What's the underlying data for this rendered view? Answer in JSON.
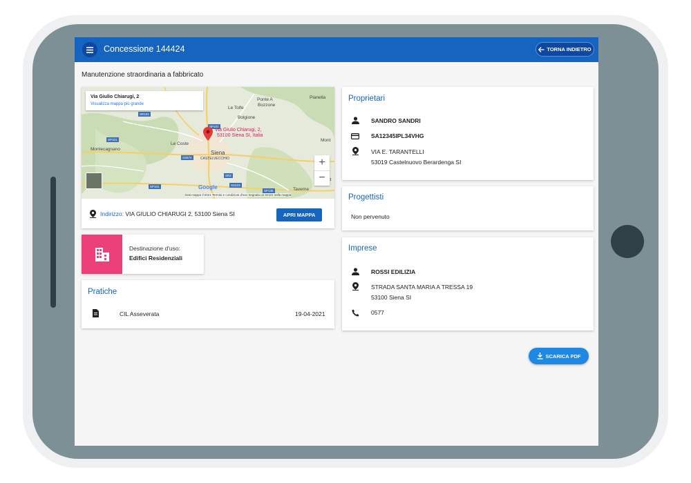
{
  "app": {
    "title": "Concessione 144424",
    "back_label": "TORNA INDIETRO",
    "menu_icon": "menu-icon",
    "primary_color": "#1565c0"
  },
  "page": {
    "subtitle": "Manutenzione straordinaria a fabbricato"
  },
  "map": {
    "popup_title": "Via Giulio Chiarugi, 2",
    "popup_link": "Visualizza mappa più grande",
    "pin_label_line1": "Via Giulio Chiarugi, 2,",
    "pin_label_line2": "53100 Siena SI, Italia",
    "places": [
      "Pianella",
      "Ponte A",
      "Bozzone",
      "Le Tolfe",
      "Bolgione",
      "Le Coste",
      "Siena",
      "CASTELVECCHIO",
      "Montecagnano",
      "Mont",
      "Taverne",
      "Mont"
    ],
    "roads": [
      "SR101",
      "SP101",
      "SP101",
      "SS674",
      "SR2",
      "SS223",
      "SP135",
      "SS73",
      "SP101"
    ],
    "google": "Google",
    "footer": "Dati mappa ©2021    Termini e condizioni d'uso    Segnala un errore nella mappa",
    "zoom_in": "+",
    "zoom_out": "−"
  },
  "address": {
    "key": "Indirizzo:",
    "value": "VIA GIULIO CHIARUGI 2, 53100 Siena SI",
    "button": "APRI MAPPA"
  },
  "destination": {
    "label": "Destinazione d'uso:",
    "value": "Edifici Residenziali",
    "color": "#ec407a"
  },
  "pratiche": {
    "title": "Pratiche",
    "items": [
      {
        "name": "CIL Asseverata",
        "date": "19-04-2021"
      }
    ]
  },
  "proprietari": {
    "title": "Proprietari",
    "name": "SANDRO SANDRI",
    "fiscal_code": "SA12345IPL34VHG",
    "address_line1": "VIA E. TARANTELLI",
    "address_line2": "53019 Castelnuovo Berardenga SI"
  },
  "progettisti": {
    "title": "Progettisti",
    "text": "Non pervenuto"
  },
  "imprese": {
    "title": "Imprese",
    "name": "ROSSI EDILIZIA",
    "address_line1": "STRADA SANTA MARIA A TRESSA 19",
    "address_line2": "53100 Siena SI",
    "phone": "0577"
  },
  "actions": {
    "pdf_label": "SCARICA PDF"
  }
}
